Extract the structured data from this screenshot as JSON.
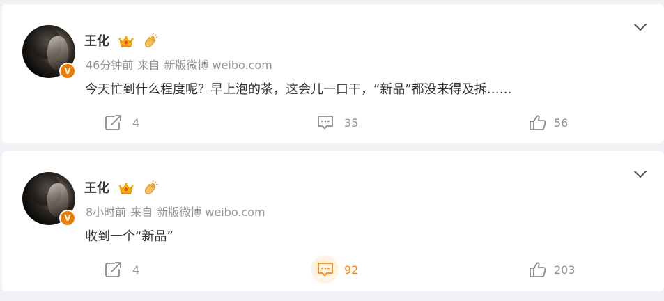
{
  "posts": [
    {
      "author": "王化",
      "time": "46分钟前",
      "source_prefix": "来自",
      "source": "新版微博 weibo.com",
      "text": "今天忙到什么程度呢？早上泡的茶，这会儿一口干，“新品”都没来得及拆……",
      "repost_count": "4",
      "comment_count": "35",
      "like_count": "56",
      "comment_active": false
    },
    {
      "author": "王化",
      "time": "8小时前",
      "source_prefix": "来自",
      "source": "新版微博 weibo.com",
      "text": "收到一个“新品”",
      "repost_count": "4",
      "comment_count": "92",
      "like_count": "203",
      "comment_active": true
    }
  ],
  "verified_badge": "V",
  "icons": {
    "avatar": "user-avatar",
    "verified": "verified-v-badge",
    "crown": "vip-crown-icon",
    "hand": "clapping-hand-icon",
    "expand": "chevron-down-icon",
    "repost": "repost-icon",
    "comment": "comment-icon",
    "like": "thumbs-up-icon"
  },
  "colors": {
    "accent": "#ff8200",
    "badge": "#ee7b00",
    "text": "#333333",
    "muted": "#939393",
    "background": "#f1f2f5"
  }
}
